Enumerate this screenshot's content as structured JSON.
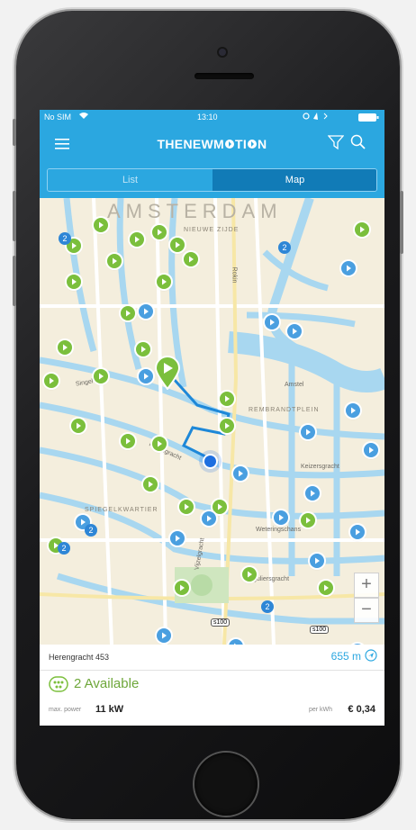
{
  "status_bar": {
    "carrier": "No SIM",
    "time": "13:10"
  },
  "app": {
    "brand_pre": "THENEW",
    "brand_post": "M",
    "brand_rest": "TI",
    "brand_end": "N"
  },
  "tabs": {
    "list_label": "List",
    "map_label": "Map",
    "selected": "Map"
  },
  "map": {
    "district_labels": [
      "AMSTERDAM",
      "NIEUWE ZIJDE",
      "REMBRANDTPLEIN",
      "SPIEGELKWARTIER"
    ],
    "street_labels": [
      "Amstel",
      "Rokin",
      "Singel",
      "Herengracht",
      "Keizersgracht",
      "Vijzelgracht",
      "Reguliersgracht",
      "Weteringschans"
    ],
    "cluster_counts": [
      "2",
      "2",
      "2",
      "2",
      "2"
    ],
    "route_shields": [
      "s100",
      "s100"
    ],
    "zoom_in_label": "+",
    "zoom_out_label": "−"
  },
  "station": {
    "address": "Herengracht 453",
    "distance": "655 m",
    "availability": "2 Available",
    "power_label": "max. power",
    "power_value": "11 kW",
    "price_label": "per kWh",
    "price_value": "€ 0,34"
  },
  "colors": {
    "brand_blue": "#2ba7e0",
    "available_green": "#7bbf3c",
    "canal_blue": "#a8d7f0",
    "route_blue": "#1e88d8"
  }
}
